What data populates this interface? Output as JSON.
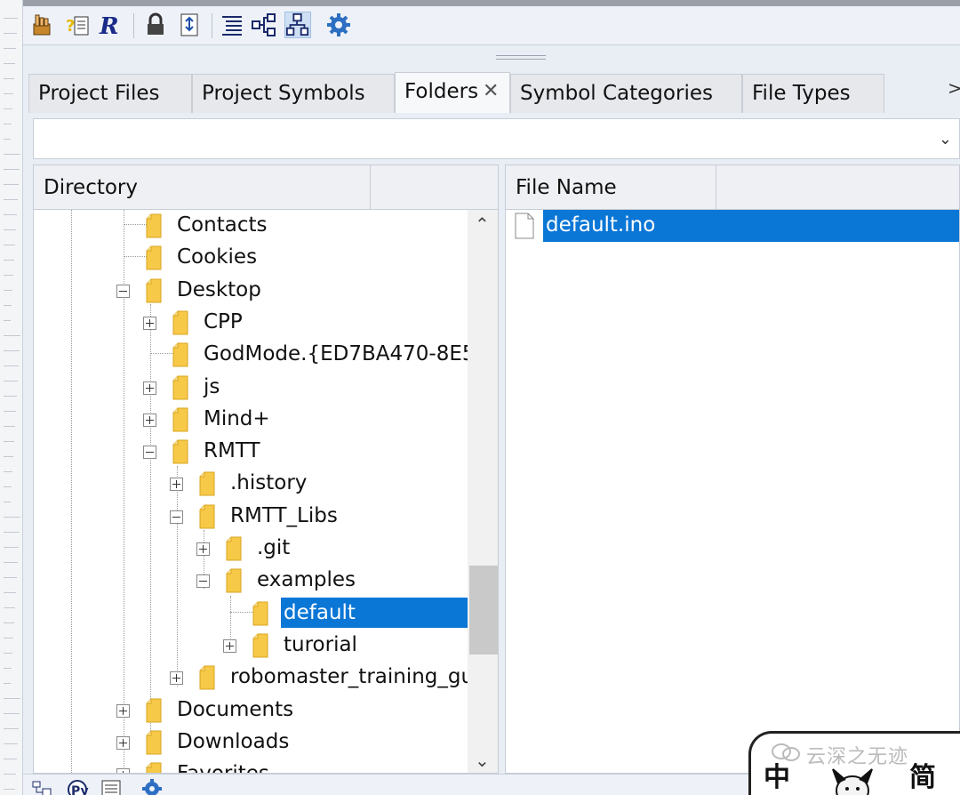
{
  "tabs": [
    {
      "label": "Project Files"
    },
    {
      "label": "Project Symbols"
    },
    {
      "label": "Folders",
      "close": "✕"
    },
    {
      "label": "Symbol Categories"
    },
    {
      "label": "File Types"
    }
  ],
  "tab_more": ">",
  "combo": {
    "value": ""
  },
  "directory_panel": {
    "header": "Directory",
    "rows": [
      {
        "label": "Contacts"
      },
      {
        "label": "Cookies"
      },
      {
        "label": "Desktop"
      },
      {
        "label": "CPP"
      },
      {
        "label": "GodMode.{ED7BA470-8E5"
      },
      {
        "label": "js"
      },
      {
        "label": "Mind+"
      },
      {
        "label": "RMTT"
      },
      {
        "label": ".history"
      },
      {
        "label": "RMTT_Libs"
      },
      {
        "label": ".git"
      },
      {
        "label": "examples"
      },
      {
        "label": "default"
      },
      {
        "label": "turorial"
      },
      {
        "label": "robomaster_training_gu"
      },
      {
        "label": "Documents"
      },
      {
        "label": "Downloads"
      },
      {
        "label": "Favorites"
      }
    ]
  },
  "file_panel": {
    "header": "File Name",
    "files": [
      {
        "name": "default.ino"
      }
    ]
  },
  "watermark": {
    "text": "云深之无迹",
    "left_glyph": "中",
    "right_glyph": "简"
  },
  "colors": {
    "selection": "#0a76d6",
    "folder": "#f5c542",
    "chrome": "#e9eef5"
  },
  "icons": {
    "toolbar": [
      "hand-pointer-icon",
      "help-icon",
      "regex-icon",
      "lock-icon",
      "sync-icon",
      "list-icon",
      "tree-icon",
      "hierarchy-icon",
      "gear-icon"
    ],
    "bottom": [
      "folder-tree-icon",
      "python-icon",
      "document-icon",
      "gear-icon"
    ]
  }
}
